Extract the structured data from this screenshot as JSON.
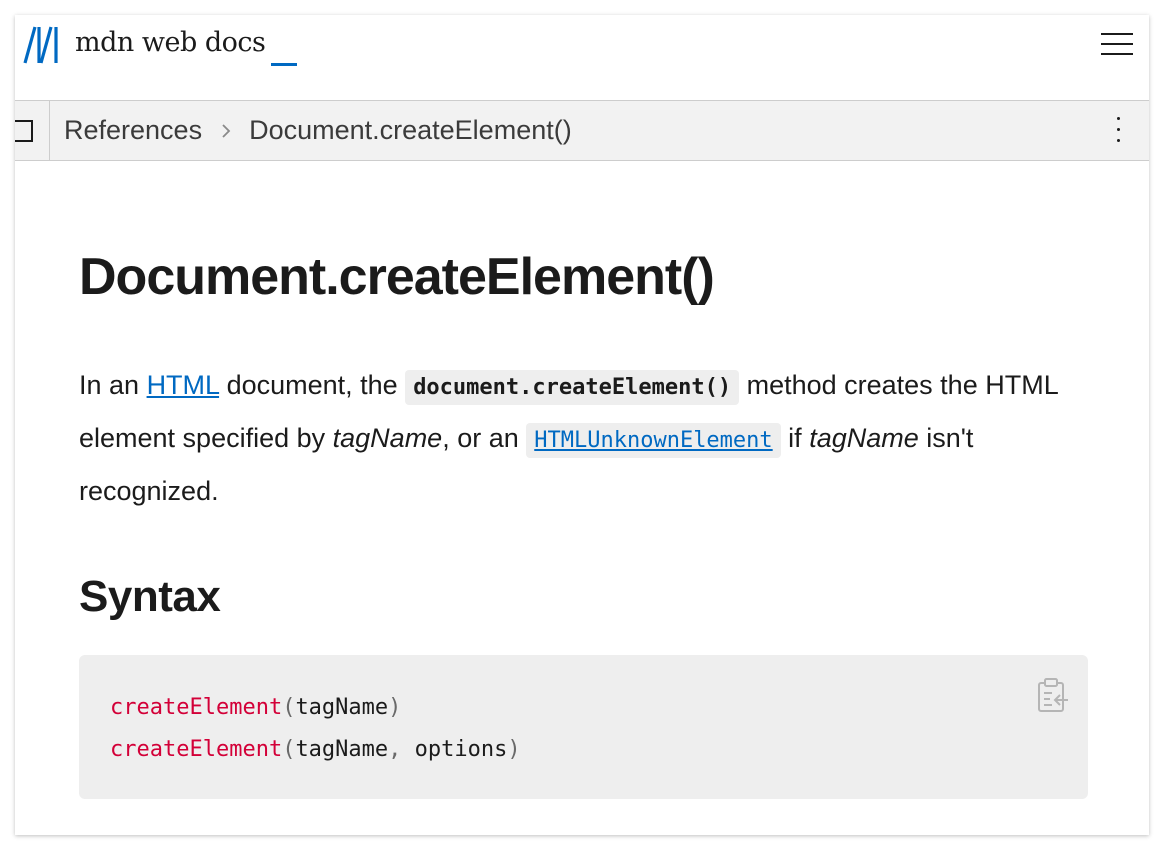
{
  "header": {
    "logo_text": "mdn web docs",
    "menu_icon": "hamburger-menu-icon",
    "brand_color": "#0069c2"
  },
  "breadcrumb": {
    "items": [
      "References",
      "Document.createElement()"
    ]
  },
  "article": {
    "title": "Document.createElement()",
    "intro": {
      "t1": "In an ",
      "link_html": "HTML",
      "t2": " document, the ",
      "code_method": "document.createElement()",
      "t3": " method creates the HTML element specified by ",
      "em_tagname": "tagName",
      "t4": ", or an ",
      "link_unknown": "HTMLUnknownElement",
      "t5": " if ",
      "em_tagname2": "tagName",
      "t6": " isn't recognized."
    },
    "syntax_heading": "Syntax",
    "syntax_lines": [
      {
        "fn": "createElement",
        "open": "(",
        "args": "tagName",
        "sep": "",
        "args2": "",
        "close": ")"
      },
      {
        "fn": "createElement",
        "open": "(",
        "args": "tagName",
        "sep": ", ",
        "args2": "options",
        "close": ")"
      }
    ],
    "copy_icon": "clipboard-copy-icon"
  }
}
